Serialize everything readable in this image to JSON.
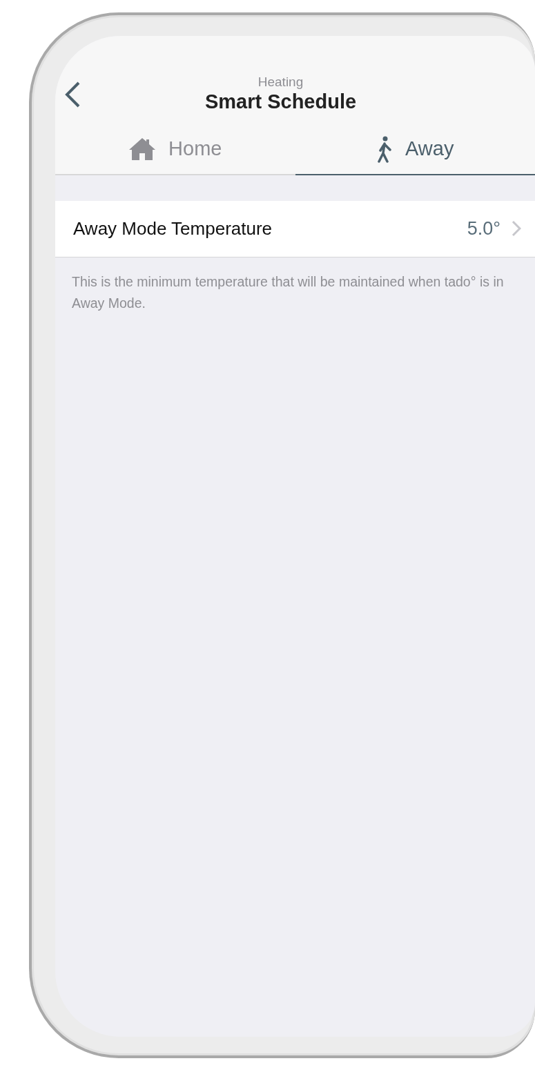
{
  "header": {
    "subtitle": "Heating",
    "title": "Smart Schedule"
  },
  "tabs": [
    {
      "label": "Home",
      "kind": "home",
      "selected": false
    },
    {
      "label": "Away",
      "kind": "away",
      "selected": true
    }
  ],
  "setting": {
    "label": "Away Mode Temperature",
    "value": "5.0°"
  },
  "description": "This is the minimum temperature that will be maintained when tado° is in Away Mode."
}
